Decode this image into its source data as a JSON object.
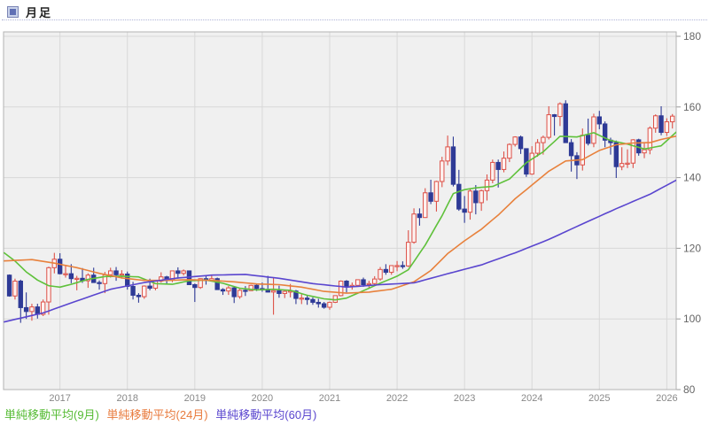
{
  "header": {
    "title": "月足"
  },
  "legend": {
    "items": [
      {
        "label": "単純移動平均(9月)",
        "color": "#55bb33"
      },
      {
        "label": "単純移動平均(24月)",
        "color": "#e87a3c"
      },
      {
        "label": "単純移動平均(60月)",
        "color": "#5a46cf"
      }
    ]
  },
  "chart_data": {
    "type": "candlestick",
    "timeframe": "monthly",
    "title": "月足",
    "start_month": "2016-04",
    "y_axis": {
      "ticks": [
        180,
        160,
        140,
        120,
        100,
        80
      ],
      "min": 80,
      "max": 180
    },
    "x_axis": {
      "year_labels": [
        "2017",
        "2018",
        "2019",
        "2020",
        "2021",
        "2022",
        "2023",
        "2024",
        "2025",
        "2026"
      ]
    },
    "colors": {
      "up_stroke": "#dd5148",
      "up_fill": "#fdf2f0",
      "down": "#2e3a96",
      "ma9": "#5fc13b",
      "ma24": "#e8813c",
      "ma60": "#5a46cf",
      "grid": "#d8d8d8",
      "plot_bg": "#f0f0f0",
      "border": "#b3b3b3",
      "tick_text": "#666666",
      "year_text": "#888888"
    },
    "candles_ohlc": [
      [
        112.4,
        112.6,
        106.3,
        106.5
      ],
      [
        106.5,
        111.4,
        105.5,
        110.7
      ],
      [
        110.7,
        111.1,
        98.9,
        103.2
      ],
      [
        103.2,
        107.5,
        100.0,
        102.1
      ],
      [
        102.1,
        104.3,
        99.5,
        103.4
      ],
      [
        103.4,
        104.3,
        100.1,
        101.3
      ],
      [
        101.3,
        105.5,
        100.8,
        104.8
      ],
      [
        104.8,
        114.8,
        101.2,
        114.5
      ],
      [
        114.5,
        118.7,
        112.9,
        116.9
      ],
      [
        116.9,
        118.6,
        112.6,
        112.8
      ],
      [
        112.8,
        115.0,
        111.7,
        112.8
      ],
      [
        112.8,
        115.5,
        110.1,
        111.4
      ],
      [
        111.4,
        112.2,
        108.1,
        111.5
      ],
      [
        111.5,
        114.4,
        110.2,
        110.8
      ],
      [
        110.8,
        112.9,
        108.8,
        112.4
      ],
      [
        112.4,
        114.5,
        110.6,
        110.3
      ],
      [
        110.3,
        110.9,
        108.3,
        110.0
      ],
      [
        110.0,
        113.3,
        107.3,
        112.5
      ],
      [
        112.5,
        114.5,
        111.7,
        113.6
      ],
      [
        113.6,
        114.7,
        110.8,
        112.5
      ],
      [
        112.5,
        113.8,
        111.4,
        112.7
      ],
      [
        112.7,
        113.4,
        108.3,
        109.2
      ],
      [
        109.2,
        110.5,
        105.5,
        106.7
      ],
      [
        106.7,
        107.3,
        104.6,
        106.3
      ],
      [
        106.3,
        109.5,
        105.7,
        109.3
      ],
      [
        109.3,
        111.4,
        108.1,
        108.7
      ],
      [
        108.7,
        110.9,
        108.1,
        110.7
      ],
      [
        110.7,
        113.2,
        110.3,
        111.9
      ],
      [
        111.9,
        112.2,
        109.8,
        111.0
      ],
      [
        111.0,
        113.7,
        110.4,
        113.6
      ],
      [
        113.6,
        114.6,
        111.4,
        112.9
      ],
      [
        112.9,
        114.0,
        112.3,
        113.6
      ],
      [
        113.6,
        113.7,
        109.6,
        109.7
      ],
      [
        109.7,
        110.0,
        104.8,
        108.9
      ],
      [
        108.9,
        111.5,
        108.5,
        111.4
      ],
      [
        111.4,
        112.1,
        109.7,
        110.9
      ],
      [
        110.9,
        112.4,
        110.8,
        111.4
      ],
      [
        111.4,
        111.7,
        108.3,
        108.3
      ],
      [
        108.3,
        108.7,
        106.8,
        107.9
      ],
      [
        107.9,
        109.3,
        106.8,
        108.8
      ],
      [
        108.8,
        109.3,
        104.5,
        106.3
      ],
      [
        106.3,
        108.5,
        105.7,
        108.1
      ],
      [
        108.1,
        109.3,
        106.5,
        108.0
      ],
      [
        108.0,
        109.7,
        107.9,
        109.5
      ],
      [
        109.5,
        109.7,
        107.9,
        108.6
      ],
      [
        108.6,
        110.3,
        107.7,
        108.4
      ],
      [
        108.4,
        112.2,
        107.5,
        107.6
      ],
      [
        107.6,
        111.7,
        101.2,
        108.0
      ],
      [
        108.0,
        109.4,
        106.0,
        107.2
      ],
      [
        107.2,
        108.1,
        105.9,
        107.8
      ],
      [
        107.8,
        109.9,
        106.1,
        107.9
      ],
      [
        107.9,
        108.2,
        104.2,
        105.8
      ],
      [
        105.8,
        107.0,
        104.2,
        105.9
      ],
      [
        105.9,
        106.6,
        104.0,
        105.5
      ],
      [
        105.5,
        106.1,
        104.0,
        104.7
      ],
      [
        104.7,
        105.7,
        103.2,
        104.3
      ],
      [
        104.3,
        104.8,
        102.9,
        103.3
      ],
      [
        103.3,
        104.9,
        102.6,
        104.7
      ],
      [
        104.7,
        106.7,
        104.5,
        106.6
      ],
      [
        106.6,
        110.9,
        106.4,
        110.7
      ],
      [
        110.7,
        111.0,
        107.5,
        109.3
      ],
      [
        109.3,
        110.3,
        108.3,
        109.5
      ],
      [
        109.5,
        111.1,
        109.2,
        111.1
      ],
      [
        111.1,
        111.7,
        109.1,
        109.7
      ],
      [
        109.7,
        110.8,
        108.7,
        110.0
      ],
      [
        110.0,
        112.1,
        109.6,
        111.3
      ],
      [
        111.3,
        114.7,
        110.8,
        114.0
      ],
      [
        114.0,
        115.5,
        112.5,
        113.2
      ],
      [
        113.2,
        115.0,
        112.5,
        115.1
      ],
      [
        115.0,
        116.4,
        113.5,
        115.1
      ],
      [
        115.1,
        116.3,
        114.2,
        115.0
      ],
      [
        115.0,
        125.1,
        114.7,
        121.7
      ],
      [
        121.7,
        131.3,
        121.3,
        129.7
      ],
      [
        129.7,
        131.3,
        126.4,
        128.7
      ],
      [
        128.7,
        137.0,
        128.6,
        135.7
      ],
      [
        135.7,
        139.4,
        132.5,
        133.3
      ],
      [
        133.3,
        139.1,
        130.4,
        138.9
      ],
      [
        138.9,
        145.9,
        137.3,
        144.7
      ],
      [
        144.7,
        151.9,
        143.5,
        148.7
      ],
      [
        148.7,
        151.6,
        137.5,
        138.1
      ],
      [
        138.1,
        142.2,
        130.6,
        131.1
      ],
      [
        131.1,
        134.8,
        127.2,
        130.2
      ],
      [
        130.2,
        136.9,
        128.1,
        136.2
      ],
      [
        136.2,
        137.9,
        129.6,
        132.9
      ],
      [
        132.9,
        136.6,
        130.6,
        136.3
      ],
      [
        136.3,
        140.9,
        133.5,
        139.3
      ],
      [
        139.3,
        145.1,
        138.4,
        144.3
      ],
      [
        144.3,
        145.1,
        137.2,
        142.3
      ],
      [
        142.3,
        147.4,
        141.5,
        145.5
      ],
      [
        145.5,
        149.7,
        144.4,
        149.4
      ],
      [
        149.4,
        151.7,
        148.8,
        151.5
      ],
      [
        151.5,
        151.9,
        146.7,
        148.2
      ],
      [
        148.2,
        148.3,
        140.2,
        141.0
      ],
      [
        141.0,
        148.9,
        140.8,
        146.9
      ],
      [
        146.9,
        150.9,
        145.9,
        149.9
      ],
      [
        149.9,
        151.9,
        146.5,
        151.4
      ],
      [
        151.4,
        160.2,
        150.8,
        157.8
      ],
      [
        157.8,
        158.0,
        151.9,
        157.3
      ],
      [
        157.3,
        161.3,
        154.6,
        160.9
      ],
      [
        160.9,
        161.9,
        151.9,
        149.9
      ],
      [
        149.9,
        150.9,
        141.7,
        146.2
      ],
      [
        146.2,
        147.2,
        139.6,
        143.6
      ],
      [
        143.6,
        153.9,
        142.0,
        152.0
      ],
      [
        152.0,
        156.7,
        149.1,
        149.7
      ],
      [
        149.7,
        158.1,
        148.6,
        157.2
      ],
      [
        157.2,
        158.9,
        153.7,
        155.2
      ],
      [
        155.2,
        155.9,
        148.6,
        150.6
      ],
      [
        150.6,
        151.3,
        146.5,
        149.9
      ],
      [
        149.9,
        150.5,
        139.9,
        143.1
      ],
      [
        143.1,
        148.6,
        142.1,
        144.0
      ],
      [
        144.0,
        148.0,
        142.7,
        144.1
      ],
      [
        144.1,
        150.9,
        142.7,
        150.7
      ],
      [
        150.7,
        151.0,
        146.2,
        147.0
      ],
      [
        147.0,
        149.9,
        145.5,
        147.9
      ],
      [
        147.9,
        154.5,
        146.6,
        154.0
      ],
      [
        154.0,
        157.9,
        152.7,
        157.5
      ],
      [
        157.5,
        160.2,
        152.0,
        152.8
      ],
      [
        152.8,
        156.8,
        151.8,
        155.8
      ],
      [
        155.8,
        158.0,
        153.9,
        157.4
      ]
    ],
    "ma_series": [
      {
        "name": "単純移動平均(9月)",
        "period": 9,
        "color": "#5fc13b",
        "anchors": [
          [
            0,
            117.6
          ],
          [
            1,
            116.4
          ],
          [
            3,
            113.3
          ],
          [
            5,
            111.0
          ],
          [
            7,
            109.4
          ],
          [
            9,
            109.0
          ],
          [
            11,
            109.8
          ],
          [
            14,
            111.2
          ],
          [
            17,
            112.0
          ],
          [
            20,
            112.1
          ],
          [
            23,
            111.9
          ],
          [
            26,
            110.0
          ],
          [
            29,
            109.8
          ],
          [
            32,
            110.8
          ],
          [
            35,
            111.0
          ],
          [
            38,
            110.1
          ],
          [
            41,
            108.7
          ],
          [
            44,
            108.2
          ],
          [
            47,
            108.4
          ],
          [
            50,
            108.1
          ],
          [
            53,
            106.7
          ],
          [
            56,
            105.7
          ],
          [
            58,
            105.4
          ],
          [
            60,
            105.9
          ],
          [
            63,
            108.0
          ],
          [
            66,
            110.1
          ],
          [
            69,
            112.1
          ],
          [
            71,
            113.9
          ],
          [
            74,
            120.9
          ],
          [
            77,
            129.2
          ],
          [
            79,
            135.5
          ],
          [
            81,
            136.6
          ],
          [
            83,
            137.1
          ],
          [
            86,
            137.5
          ],
          [
            89,
            139.6
          ],
          [
            92,
            144.2
          ],
          [
            95,
            147.3
          ],
          [
            98,
            151.7
          ],
          [
            101,
            151.5
          ],
          [
            104,
            152.7
          ],
          [
            107,
            150.5
          ],
          [
            110,
            149.5
          ],
          [
            113,
            148.1
          ],
          [
            116,
            149.0
          ],
          [
            118,
            151.9
          ]
        ]
      },
      {
        "name": "単純移動平均(24月)",
        "period": 24,
        "color": "#e8813c",
        "anchors": [
          [
            0,
            116.5
          ],
          [
            4,
            116.8
          ],
          [
            8,
            115.8
          ],
          [
            12,
            114.5
          ],
          [
            16,
            112.9
          ],
          [
            20,
            111.6
          ],
          [
            24,
            110.9
          ],
          [
            28,
            110.9
          ],
          [
            32,
            111.1
          ],
          [
            36,
            110.9
          ],
          [
            40,
            110.5
          ],
          [
            44,
            109.9
          ],
          [
            48,
            109.7
          ],
          [
            52,
            109.0
          ],
          [
            56,
            107.8
          ],
          [
            60,
            107.3
          ],
          [
            64,
            107.6
          ],
          [
            68,
            108.4
          ],
          [
            72,
            110.5
          ],
          [
            75,
            113.7
          ],
          [
            78,
            118.5
          ],
          [
            81,
            122.1
          ],
          [
            84,
            125.4
          ],
          [
            87,
            129.4
          ],
          [
            90,
            134.0
          ],
          [
            93,
            137.9
          ],
          [
            96,
            141.8
          ],
          [
            99,
            144.7
          ],
          [
            102,
            145.1
          ],
          [
            105,
            147.7
          ],
          [
            108,
            149.3
          ],
          [
            111,
            149.8
          ],
          [
            114,
            149.9
          ],
          [
            116,
            150.8
          ],
          [
            118,
            151.5
          ]
        ]
      },
      {
        "name": "単純移動平均(60月)",
        "period": 60,
        "color": "#5a46cf",
        "anchors": [
          [
            0,
            99.5
          ],
          [
            6,
            101.7
          ],
          [
            12,
            105.1
          ],
          [
            18,
            108.4
          ],
          [
            24,
            110.3
          ],
          [
            30,
            111.6
          ],
          [
            36,
            112.4
          ],
          [
            42,
            112.6
          ],
          [
            48,
            111.5
          ],
          [
            54,
            110.0
          ],
          [
            60,
            109.0
          ],
          [
            66,
            109.7
          ],
          [
            72,
            110.2
          ],
          [
            78,
            112.8
          ],
          [
            84,
            115.3
          ],
          [
            90,
            118.7
          ],
          [
            96,
            122.5
          ],
          [
            102,
            126.9
          ],
          [
            108,
            131.2
          ],
          [
            114,
            135.3
          ],
          [
            118,
            138.7
          ]
        ]
      }
    ]
  }
}
